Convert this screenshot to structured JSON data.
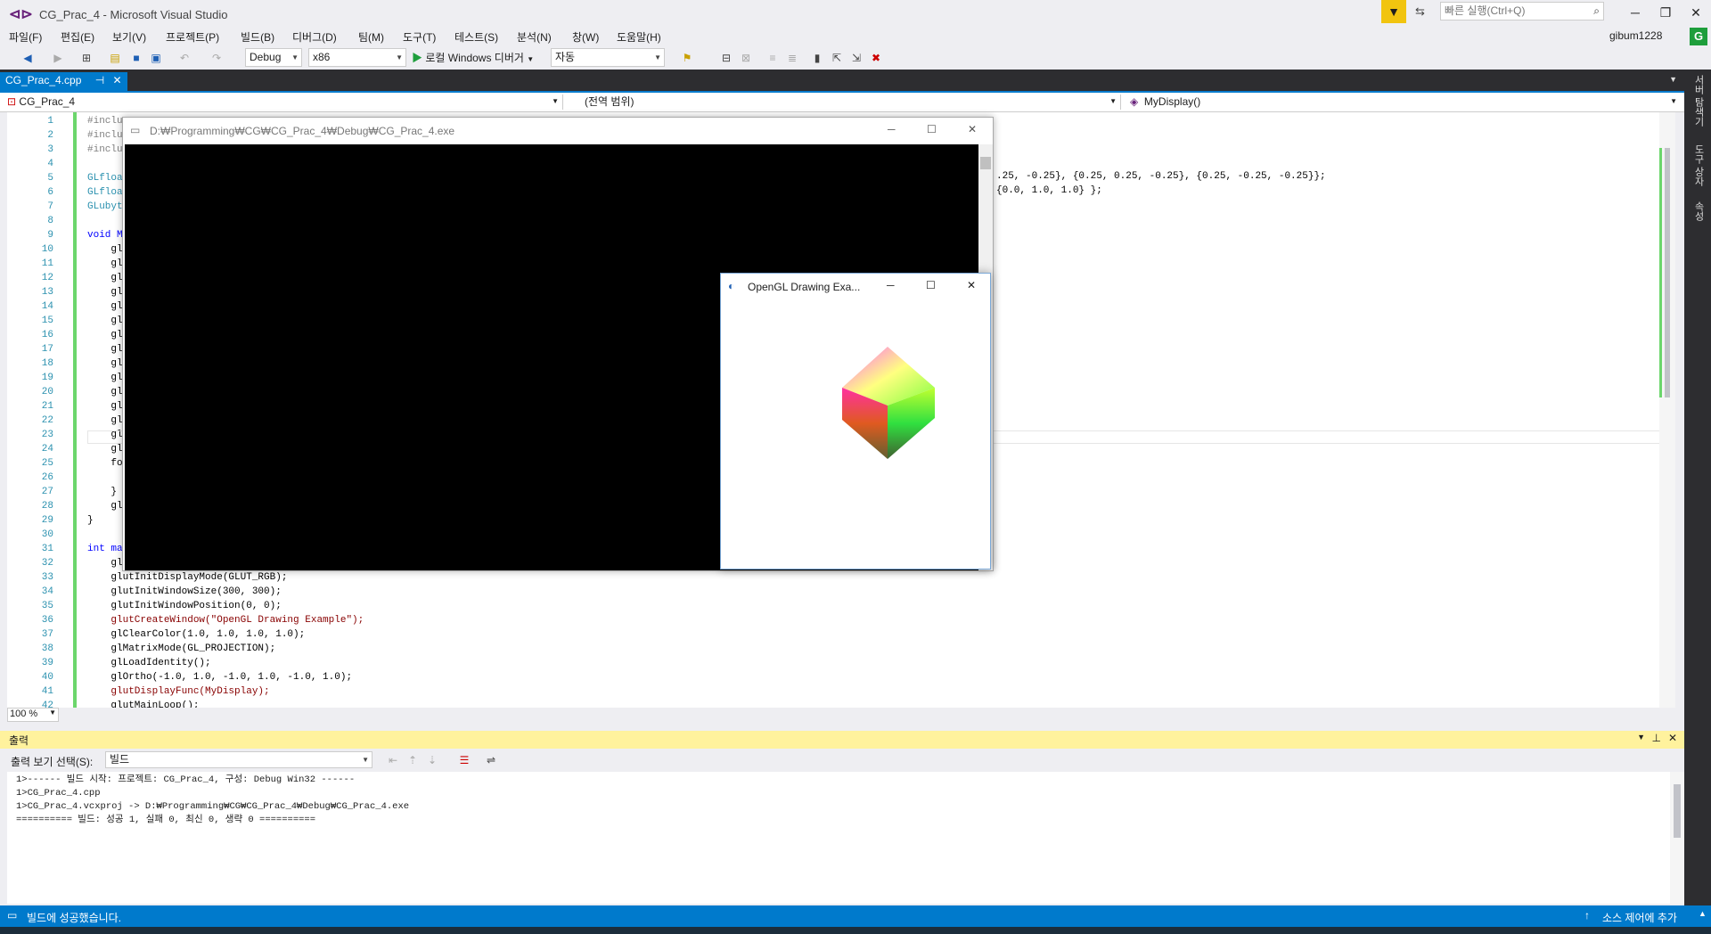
{
  "window": {
    "title": "CG_Prac_4 - Microsoft Visual Studio",
    "quick_launch_placeholder": "빠른 실행(Ctrl+Q)",
    "user": "gibum1228",
    "user_initial": "G"
  },
  "menu": [
    "파일(F)",
    "편집(E)",
    "보기(V)",
    "프로젝트(P)",
    "빌드(B)",
    "디버그(D)",
    "팀(M)",
    "도구(T)",
    "테스트(S)",
    "분석(N)",
    "창(W)",
    "도움말(H)"
  ],
  "toolbar": {
    "config": "Debug",
    "platform": "x86",
    "run_label": "로컬 Windows 디버거",
    "run_mode": "자동"
  },
  "tab": {
    "name": "CG_Prac_4.cpp"
  },
  "nav": {
    "project": "CG_Prac_4",
    "scope": "(전역 범위)",
    "member": "MyDisplay()"
  },
  "code_lines": [
    {
      "n": "1",
      "t": "#inclu"
    },
    {
      "n": "2",
      "t": "#inclu"
    },
    {
      "n": "3",
      "t": "#inclu"
    },
    {
      "n": "4",
      "t": ""
    },
    {
      "n": "5",
      "t": "GLfloa"
    },
    {
      "n": "6",
      "t": "GLfloa"
    },
    {
      "n": "7",
      "t": "GLubyt"
    },
    {
      "n": "8",
      "t": ""
    },
    {
      "n": "9",
      "t": "void M"
    },
    {
      "n": "10",
      "t": "    gl"
    },
    {
      "n": "11",
      "t": "    gl"
    },
    {
      "n": "12",
      "t": "    gl"
    },
    {
      "n": "13",
      "t": "    gl"
    },
    {
      "n": "14",
      "t": "    gl"
    },
    {
      "n": "15",
      "t": "    gl"
    },
    {
      "n": "16",
      "t": "    gl"
    },
    {
      "n": "17",
      "t": "    gl"
    },
    {
      "n": "18",
      "t": "    gl"
    },
    {
      "n": "19",
      "t": "    gl"
    },
    {
      "n": "20",
      "t": "    gl"
    },
    {
      "n": "21",
      "t": "    gl"
    },
    {
      "n": "22",
      "t": "    gl"
    },
    {
      "n": "23",
      "t": "    gl"
    },
    {
      "n": "24",
      "t": "    gl"
    },
    {
      "n": "25",
      "t": "    fo"
    },
    {
      "n": "26",
      "t": ""
    },
    {
      "n": "27",
      "t": "    }"
    },
    {
      "n": "28",
      "t": "    gl"
    },
    {
      "n": "29",
      "t": "}"
    },
    {
      "n": "30",
      "t": ""
    },
    {
      "n": "31",
      "t": "int ma"
    },
    {
      "n": "32",
      "t": "    gl"
    },
    {
      "n": "33",
      "t": "    glutInitDisplayMode(GLUT_RGB);"
    },
    {
      "n": "34",
      "t": "    glutInitWindowSize(300, 300);"
    },
    {
      "n": "35",
      "t": "    glutInitWindowPosition(0, 0);"
    },
    {
      "n": "36",
      "t": "    glutCreateWindow(\"OpenGL Drawing Example\");"
    },
    {
      "n": "37",
      "t": "    glClearColor(1.0, 1.0, 1.0, 1.0);"
    },
    {
      "n": "38",
      "t": "    glMatrixMode(GL_PROJECTION);"
    },
    {
      "n": "39",
      "t": "    glLoadIdentity();"
    },
    {
      "n": "40",
      "t": "    glOrtho(-1.0, 1.0, -1.0, 1.0, -1.0, 1.0);"
    },
    {
      "n": "41",
      "t": "    glutDisplayFunc(MyDisplay);"
    },
    {
      "n": "42",
      "t": "    glutMainLoop();"
    }
  ],
  "code_right": {
    "line5": ".25, -0.25}, {0.25, 0.25, -0.25}, {0.25, -0.25, -0.25}};",
    "line6": "{0.0, 1.0, 1.0} };"
  },
  "zoom": "100 %",
  "console": {
    "title": "D:₩Programming₩CG₩CG_Prac_4₩Debug₩CG_Prac_4.exe"
  },
  "glwin": {
    "title": "OpenGL Drawing Exa..."
  },
  "right_strip": [
    "서버 탐색기",
    "도구 상자",
    "속성"
  ],
  "output": {
    "title": "출력",
    "source_label": "출력 보기 선택(S):",
    "source": "빌드",
    "lines": [
      "1>------ 빌드 시작: 프로젝트: CG_Prac_4, 구성: Debug Win32 ------",
      "1>CG_Prac_4.cpp",
      "1>CG_Prac_4.vcxproj -> D:₩Programming₩CG₩CG_Prac_4₩Debug₩CG_Prac_4.exe",
      "========== 빌드: 성공 1, 실패 0, 최신 0, 생략 0 =========="
    ]
  },
  "status": {
    "message": "빌드에 성공했습니다.",
    "source_control": "소스 제어에 추가"
  },
  "colors": {
    "accent": "#007acc",
    "dark": "#2d2d30",
    "output_header": "#fff29d",
    "change_bar": "#6cd66c"
  }
}
